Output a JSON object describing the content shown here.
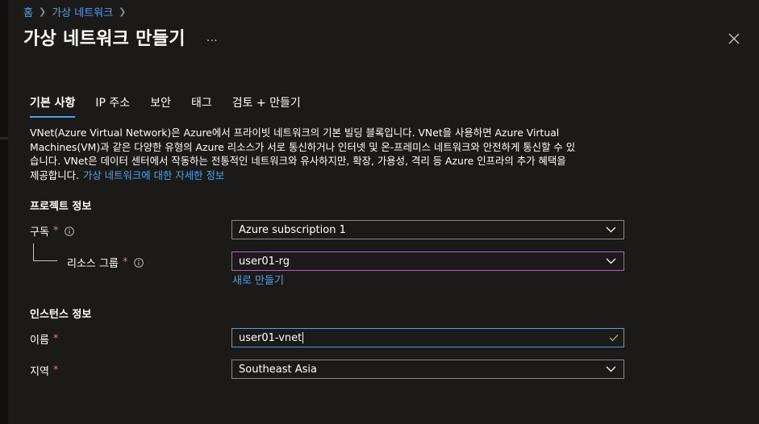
{
  "breadcrumb": {
    "items": [
      "홈",
      "가상 네트워크"
    ]
  },
  "title": "가상 네트워크 만들기",
  "more_label": "…",
  "tabs": [
    {
      "label": "기본 사항"
    },
    {
      "label": "IP 주소"
    },
    {
      "label": "보안"
    },
    {
      "label": "태그"
    },
    {
      "label": "검토 + 만들기"
    }
  ],
  "description": {
    "line1": "VNet(Azure Virtual Network)은 Azure에서 프라이빗 네트워크의 기본 빌딩 블록입니다. VNet을 사용하면 Azure Virtual",
    "line2": "Machines(VM)과 같은 다양한 유형의 Azure 리소스가 서로 통신하거나 인터넷 및 온-프레미스 네트워크와 안전하게 통신할 수 있",
    "line3": "습니다. VNet은 데이터 센터에서 작동하는 전통적인 네트워크와 유사하지만, 확장, 가용성, 격리 등 Azure 인프라의 추가 혜택을",
    "line4": "제공합니다.",
    "learn_more_link": "가상 네트워크에 대한 자세한 정보"
  },
  "project": {
    "heading": "프로젝트 정보",
    "subscription_label": "구독",
    "subscription_value": "Azure subscription 1",
    "resource_group_label": "리소스 그룹",
    "resource_group_value": "user01-rg",
    "create_new_link": "새로 만들기"
  },
  "instance": {
    "heading": "인스턴스 정보",
    "name_label": "이름",
    "name_value": "user01-vnet",
    "region_label": "지역",
    "region_value": "Southeast Asia"
  },
  "required_marker": "*",
  "colors": {
    "background": "#1b1a19",
    "link": "#4fa1ef",
    "required": "#f1707b",
    "focus_border": "#b65ad0",
    "valid_check": "#92c353"
  }
}
